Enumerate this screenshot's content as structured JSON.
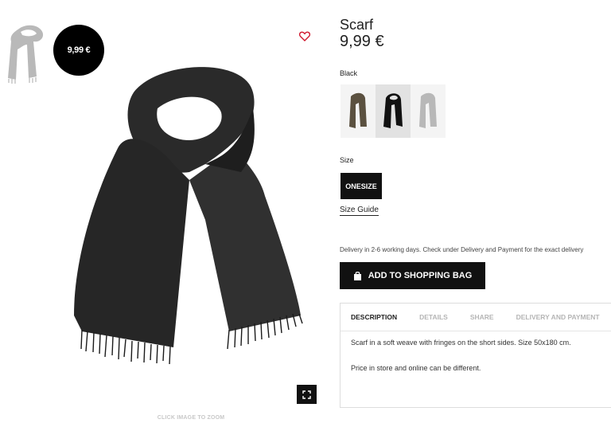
{
  "gallery": {
    "price_badge": "9,99 €",
    "zoom_hint": "CLICK IMAGE TO ZOOM"
  },
  "product": {
    "title": "Scarf",
    "price": "9,99 €",
    "color_label": "Black",
    "colors": [
      "Khaki",
      "Black",
      "Light grey"
    ],
    "size_label": "Size",
    "size_option": "ONESIZE",
    "size_guide": "Size Guide",
    "delivery": "Delivery in 2-6 working days. Check under Delivery and Payment for the exact delivery",
    "add_to_bag": "ADD TO SHOPPING BAG"
  },
  "info": {
    "tabs": [
      "DESCRIPTION",
      "DETAILS",
      "SHARE",
      "DELIVERY AND PAYMENT"
    ],
    "active_tab": "DESCRIPTION",
    "description": "Scarf in a soft weave with fringes on the short sides. Size 50x180 cm.",
    "note": "Price in store and online can be different."
  },
  "colors": {
    "accent": "#111111",
    "heart": "#d0182e"
  }
}
